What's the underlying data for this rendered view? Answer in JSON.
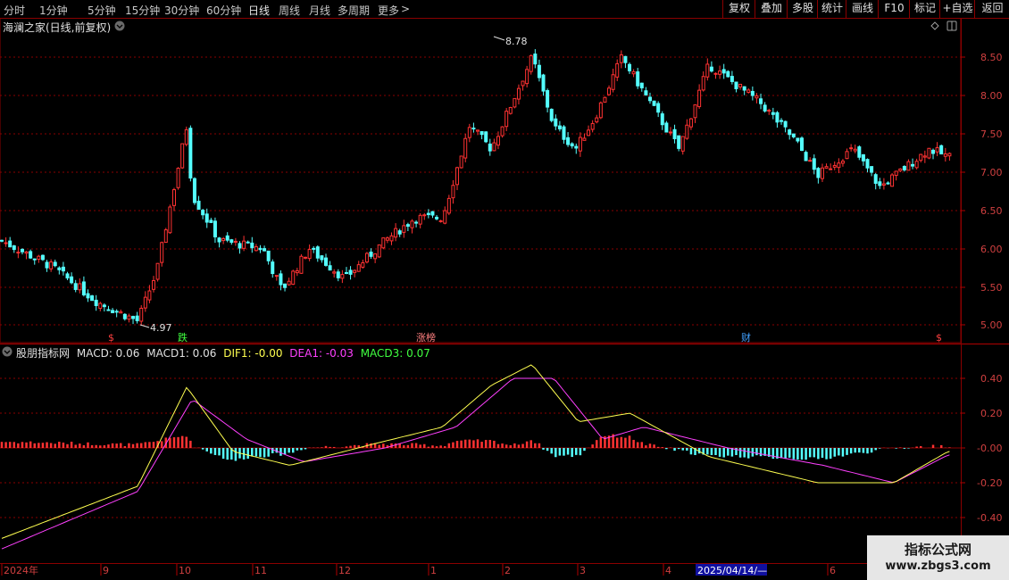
{
  "toolbar": {
    "tabs": [
      "分时",
      "1分钟",
      "5分钟",
      "15分钟",
      "30分钟",
      "60分钟",
      "日线",
      "周线",
      "月线",
      "多周期",
      "更多"
    ],
    "more_arrow": ">",
    "active_tab": "日线",
    "right_buttons": [
      "复权",
      "叠加",
      "多股",
      "统计",
      "画线",
      "F10",
      "标记",
      "+自选",
      "返回"
    ]
  },
  "main_panel": {
    "title": "海澜之家(日线,前复权)",
    "high_label": "8.78",
    "low_label": "4.97",
    "price_ticks": [
      "8.50",
      "8.00",
      "7.50",
      "7.00",
      "6.50",
      "6.00",
      "5.50",
      "5.00"
    ],
    "markers": [
      "$",
      "跌",
      "涨榜",
      "财",
      "$"
    ]
  },
  "indicator_panel": {
    "name": "股朋指标网",
    "macd": "MACD: 0.06",
    "macd1": "MACD1: 0.06",
    "dif": "DIF1: -0.00",
    "dea": "DEA1: -0.03",
    "macd3": "MACD3: 0.07",
    "ticks": [
      "0.40",
      "0.20",
      "-0.00",
      "-0.20",
      "-0.40"
    ]
  },
  "date_axis": {
    "labels": [
      "2024年",
      "9",
      "10",
      "11",
      "12",
      "1",
      "2",
      "3",
      "4",
      "6"
    ],
    "cursor_date": "2025/04/14/—"
  },
  "colors": {
    "up": "#ff3232",
    "down": "#54ffff",
    "dif": "#ffff50",
    "dea": "#ff40ff",
    "macd3": "#40ff40",
    "grid": "#8a0000"
  },
  "watermark": {
    "line1": "指标公式网",
    "line2": "www.zbgs3.com"
  },
  "chart_data": {
    "type": "candlestick",
    "title": "海澜之家(日线,前复权)",
    "ylim": [
      4.85,
      8.85
    ],
    "close_keypoints": [
      [
        "2024-08-01",
        6.1
      ],
      [
        "2024-08-20",
        5.75
      ],
      [
        "2024-09-05",
        5.3
      ],
      [
        "2024-09-20",
        5.05
      ],
      [
        "2024-09-27",
        5.7
      ],
      [
        "2024-10-08",
        7.6
      ],
      [
        "2024-10-10",
        6.7
      ],
      [
        "2024-10-20",
        6.1
      ],
      [
        "2024-11-05",
        6.0
      ],
      [
        "2024-11-12",
        5.45
      ],
      [
        "2024-11-22",
        6.0
      ],
      [
        "2024-12-05",
        5.6
      ],
      [
        "2024-12-20",
        6.1
      ],
      [
        "2024-12-31",
        6.4
      ],
      [
        "2025-01-10",
        6.4
      ],
      [
        "2025-01-20",
        7.6
      ],
      [
        "2025-01-28",
        7.3
      ],
      [
        "2025-02-12",
        8.5
      ],
      [
        "2025-02-20",
        7.6
      ],
      [
        "2025-02-28",
        7.3
      ],
      [
        "2025-03-07",
        7.7
      ],
      [
        "2025-03-17",
        8.5
      ],
      [
        "2025-04-07",
        7.3
      ],
      [
        "2025-04-18",
        8.4
      ],
      [
        "2025-05-07",
        7.9
      ],
      [
        "2025-05-20",
        7.4
      ],
      [
        "2025-05-28",
        6.95
      ],
      [
        "2025-06-10",
        7.3
      ],
      [
        "2025-06-20",
        6.8
      ],
      [
        "2025-07-08",
        7.3
      ],
      [
        "2025-07-15",
        7.2
      ]
    ],
    "macd_keypoints": {
      "dif": [
        [
          "2024-08-01",
          -0.52
        ],
        [
          "2024-09-20",
          -0.22
        ],
        [
          "2024-10-08",
          0.35
        ],
        [
          "2024-10-25",
          -0.02
        ],
        [
          "2024-11-15",
          -0.1
        ],
        [
          "2024-12-15",
          0.02
        ],
        [
          "2025-01-10",
          0.12
        ],
        [
          "2025-01-28",
          0.36
        ],
        [
          "2025-02-12",
          0.48
        ],
        [
          "2025-03-01",
          0.15
        ],
        [
          "2025-03-20",
          0.2
        ],
        [
          "2025-04-18",
          -0.05
        ],
        [
          "2025-05-28",
          -0.2
        ],
        [
          "2025-06-25",
          -0.2
        ],
        [
          "2025-07-15",
          -0.02
        ]
      ],
      "dea": [
        [
          "2024-08-01",
          -0.58
        ],
        [
          "2024-09-20",
          -0.25
        ],
        [
          "2024-10-10",
          0.28
        ],
        [
          "2024-10-30",
          0.05
        ],
        [
          "2024-11-20",
          -0.08
        ],
        [
          "2024-12-20",
          0.0
        ],
        [
          "2025-01-15",
          0.12
        ],
        [
          "2025-02-05",
          0.4
        ],
        [
          "2025-02-20",
          0.4
        ],
        [
          "2025-03-10",
          0.05
        ],
        [
          "2025-03-25",
          0.12
        ],
        [
          "2025-04-25",
          0.0
        ],
        [
          "2025-05-30",
          -0.1
        ],
        [
          "2025-06-25",
          -0.2
        ],
        [
          "2025-07-15",
          -0.04
        ]
      ]
    }
  }
}
